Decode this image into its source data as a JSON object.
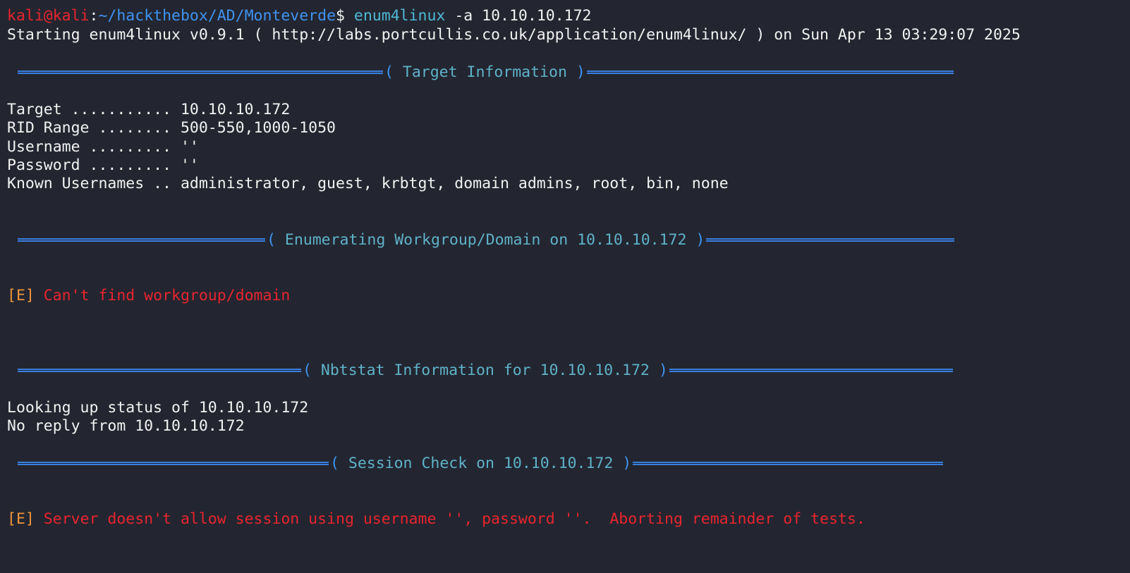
{
  "prompt": {
    "user": "kali",
    "at": "@",
    "host": "kali",
    "colon": ":",
    "path": "~/hackthebox/AD/Monteverde",
    "symbol": "$",
    "command": "enum4linux",
    "args": " -a 10.10.10.172"
  },
  "start_line": "Starting enum4linux v0.9.1 ( http://labs.portcullis.co.uk/application/enum4linux/ ) on Sun Apr 13 03:29:07 2025",
  "sections": {
    "target": {
      "open": "( ",
      "title": "Target Information",
      "close": " )"
    },
    "workgroup": {
      "open": "( ",
      "title": "Enumerating Workgroup/Domain on 10.10.10.172",
      "close": " )"
    },
    "nbtstat": {
      "open": "( ",
      "title": "Nbtstat Information for 10.10.10.172",
      "close": " )"
    },
    "session": {
      "open": "( ",
      "title": "Session Check on 10.10.10.172",
      "close": " )"
    }
  },
  "target_info": [
    "Target ........... 10.10.10.172",
    "RID Range ........ 500-550,1000-1050",
    "Username ......... ''",
    "Password ......... ''",
    "Known Usernames .. administrator, guest, krbtgt, domain admins, root, bin, none"
  ],
  "errors": {
    "tag": "[E]",
    "workgroup": "Can't find workgroup/domain",
    "session": "Server doesn't allow session using username '', password ''.  Aborting remainder of tests."
  },
  "nbtstat_output": [
    "Looking up status of 10.10.10.172",
    "No reply from 10.10.10.172"
  ],
  "colors": {
    "background": "#232630",
    "prompt_red": "#e8242f",
    "path_blue": "#3f93f2",
    "header_rule": "#3a7ee0",
    "header_title": "#5fb2c8",
    "error_tag": "#f0953a",
    "error_text": "#e8242f"
  }
}
